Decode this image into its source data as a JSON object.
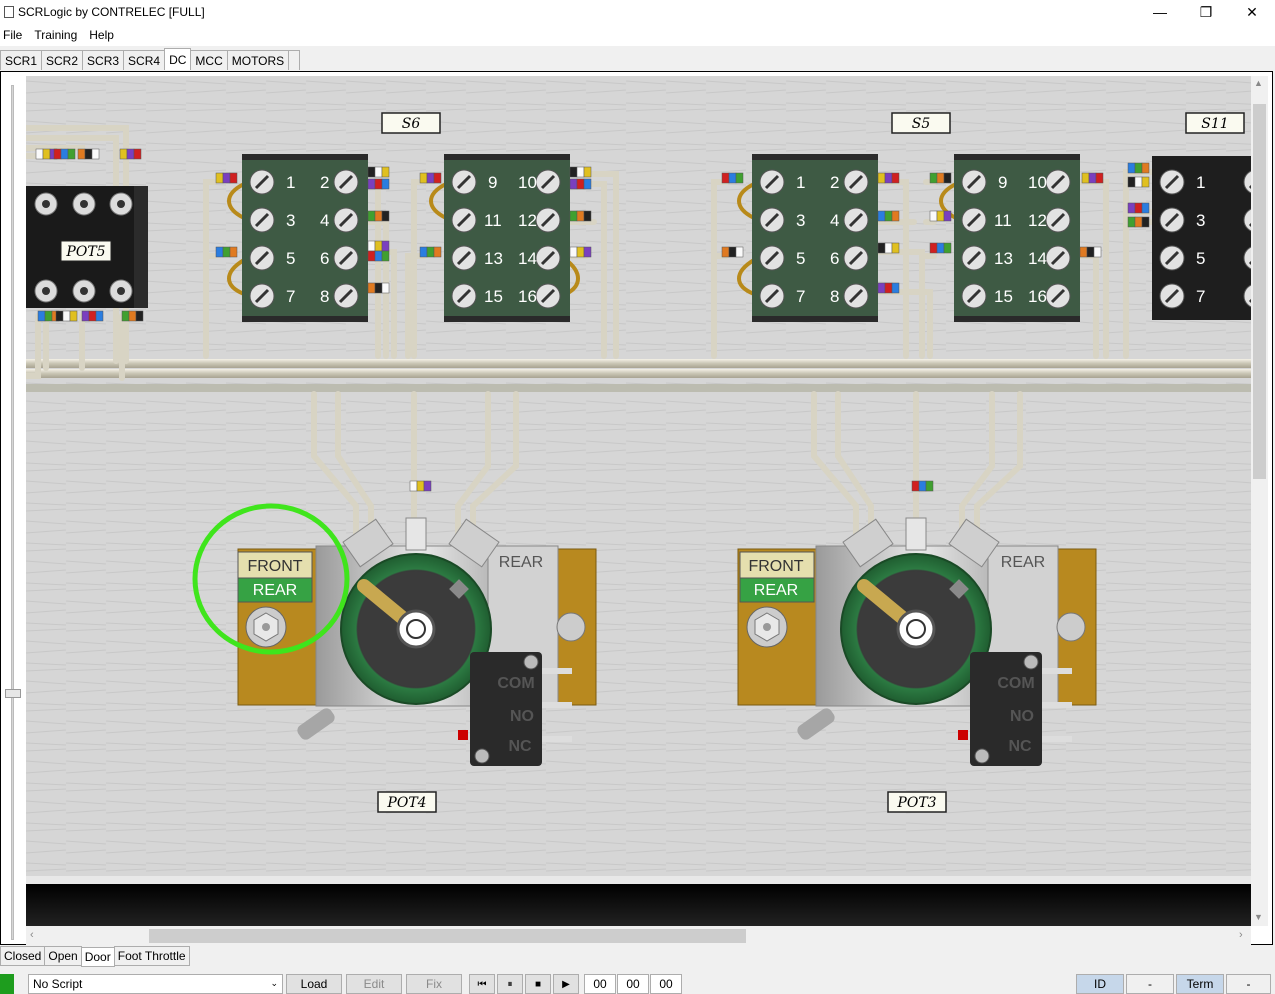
{
  "window": {
    "title": "SCRLogic by CONTRELEC [FULL]",
    "minimize": "—",
    "restore": "❐",
    "close": "✕"
  },
  "menu": [
    "File",
    "Training",
    "Help"
  ],
  "tabs": {
    "items": [
      "SCR1",
      "SCR2",
      "SCR3",
      "SCR4",
      "DC",
      "MCC",
      "MOTORS"
    ],
    "active": "DC"
  },
  "diagram": {
    "terminal_labels": {
      "s6": "S6",
      "s5": "S5",
      "s11": "S11",
      "pot5": "POT5",
      "pot4": "POT4",
      "pot3": "POT3"
    },
    "contact_numbers": {
      "left": [
        "1",
        "2",
        "3",
        "4",
        "5",
        "6",
        "7",
        "8"
      ],
      "right": [
        "9",
        "10",
        "11",
        "12",
        "13",
        "14",
        "15",
        "16"
      ]
    },
    "pot_panel": {
      "front": "FRONT",
      "rear_button": "REAR",
      "rear_label": "REAR",
      "switch_com": "COM",
      "switch_no": "NO",
      "switch_nc": "NC"
    },
    "highlight_color": "#3fe51c"
  },
  "bottom_tabs": {
    "items": [
      "Closed",
      "Open",
      "Door",
      "Foot Throttle"
    ],
    "active": "Door"
  },
  "status": {
    "script": "No Script",
    "load": "Load",
    "edit": "Edit",
    "fix": "Fix",
    "rewind_icon": "⏮",
    "pause_icon": "⏸",
    "stop_icon": "■",
    "play_icon": "▶",
    "time_h": "00",
    "time_m": "00",
    "time_s": "00",
    "id": "ID",
    "id_value": "-",
    "term": "Term",
    "term_value": "-"
  }
}
